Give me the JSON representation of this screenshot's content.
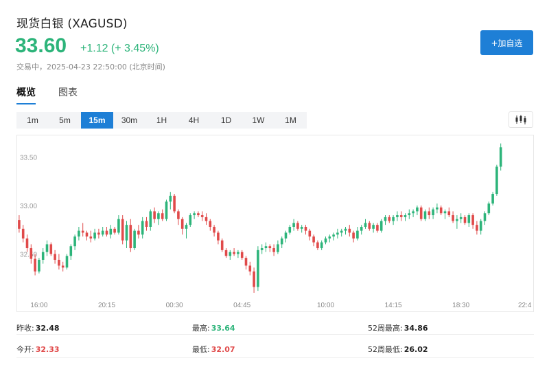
{
  "header": {
    "title": "现货白银 (XAGUSD)",
    "price": "33.60",
    "change": "+1.12 (+ 3.45%)",
    "status": "交易中，2025-04-23 22:50:00 (北京时间)",
    "follow_label": "+加自选"
  },
  "tabs": [
    {
      "label": "概览",
      "active": true
    },
    {
      "label": "图表",
      "active": false
    }
  ],
  "intervals": [
    {
      "label": "1m",
      "active": false
    },
    {
      "label": "5m",
      "active": false
    },
    {
      "label": "15m",
      "active": true
    },
    {
      "label": "30m",
      "active": false
    },
    {
      "label": "1H",
      "active": false
    },
    {
      "label": "4H",
      "active": false
    },
    {
      "label": "1D",
      "active": false
    },
    {
      "label": "1W",
      "active": false
    },
    {
      "label": "1M",
      "active": false
    }
  ],
  "chart_type_icon": "candlestick-icon",
  "colors": {
    "up": "#2db47a",
    "down": "#e04a4a",
    "accent": "#1e7fd6"
  },
  "chart_data": {
    "type": "candlestick",
    "y_ticks": [
      "33.50",
      "33.00",
      "32.50"
    ],
    "y_tick_values": [
      33.5,
      33.0,
      32.5
    ],
    "ylim": [
      32.05,
      33.68
    ],
    "x_ticks": [
      "16:00",
      "20:15",
      "00:30",
      "04:45",
      "10:00",
      "14:15",
      "18:30",
      "22:4"
    ],
    "x_tick_index": [
      5,
      22,
      39,
      56,
      77,
      94,
      111,
      128
    ],
    "n_slots": 130,
    "candles": [
      [
        32.85,
        32.9,
        32.72,
        32.76
      ],
      [
        32.76,
        32.8,
        32.62,
        32.66
      ],
      [
        32.66,
        32.7,
        32.52,
        32.56
      ],
      [
        32.56,
        32.6,
        32.4,
        32.45
      ],
      [
        32.45,
        32.5,
        32.28,
        32.32
      ],
      [
        32.32,
        32.46,
        32.3,
        32.44
      ],
      [
        32.44,
        32.56,
        32.4,
        32.52
      ],
      [
        32.52,
        32.64,
        32.48,
        32.6
      ],
      [
        32.6,
        32.62,
        32.48,
        32.5
      ],
      [
        32.5,
        32.54,
        32.4,
        32.44
      ],
      [
        32.44,
        32.5,
        32.34,
        32.38
      ],
      [
        32.38,
        32.42,
        32.32,
        32.36
      ],
      [
        32.36,
        32.5,
        32.34,
        32.48
      ],
      [
        32.48,
        32.6,
        32.44,
        32.58
      ],
      [
        32.58,
        32.7,
        32.54,
        32.68
      ],
      [
        32.68,
        32.78,
        32.64,
        32.74
      ],
      [
        32.74,
        32.82,
        32.68,
        32.72
      ],
      [
        32.72,
        32.74,
        32.64,
        32.68
      ],
      [
        32.68,
        32.74,
        32.62,
        32.66
      ],
      [
        32.66,
        32.76,
        32.64,
        32.72
      ],
      [
        32.72,
        32.76,
        32.66,
        32.7
      ],
      [
        32.7,
        32.78,
        32.68,
        32.74
      ],
      [
        32.74,
        32.78,
        32.68,
        32.7
      ],
      [
        32.7,
        32.8,
        32.66,
        32.76
      ],
      [
        32.76,
        32.78,
        32.7,
        32.72
      ],
      [
        32.72,
        32.9,
        32.7,
        32.86
      ],
      [
        32.86,
        32.9,
        32.6,
        32.64
      ],
      [
        32.64,
        32.84,
        32.56,
        32.8
      ],
      [
        32.8,
        32.86,
        32.52,
        32.56
      ],
      [
        32.56,
        32.76,
        32.54,
        32.74
      ],
      [
        32.74,
        32.8,
        32.66,
        32.7
      ],
      [
        32.7,
        32.88,
        32.66,
        32.84
      ],
      [
        32.84,
        32.88,
        32.74,
        32.78
      ],
      [
        32.78,
        32.96,
        32.74,
        32.94
      ],
      [
        32.94,
        32.98,
        32.82,
        32.86
      ],
      [
        32.86,
        32.94,
        32.8,
        32.92
      ],
      [
        32.92,
        32.96,
        32.84,
        32.86
      ],
      [
        32.86,
        33.06,
        32.84,
        33.04
      ],
      [
        33.04,
        33.14,
        32.96,
        33.1
      ],
      [
        33.1,
        33.12,
        32.92,
        32.94
      ],
      [
        32.94,
        32.96,
        32.8,
        32.86
      ],
      [
        32.86,
        32.88,
        32.7,
        32.76
      ],
      [
        32.76,
        32.82,
        32.66,
        32.8
      ],
      [
        32.8,
        32.92,
        32.78,
        32.9
      ],
      [
        32.9,
        32.94,
        32.86,
        32.92
      ],
      [
        32.92,
        32.94,
        32.88,
        32.9
      ],
      [
        32.9,
        32.94,
        32.84,
        32.88
      ],
      [
        32.88,
        32.92,
        32.8,
        32.84
      ],
      [
        32.84,
        32.86,
        32.74,
        32.78
      ],
      [
        32.78,
        32.8,
        32.68,
        32.72
      ],
      [
        32.72,
        32.74,
        32.6,
        32.64
      ],
      [
        32.64,
        32.66,
        32.52,
        32.54
      ],
      [
        32.54,
        32.56,
        32.46,
        32.48
      ],
      [
        32.48,
        32.54,
        32.44,
        32.52
      ],
      [
        32.52,
        32.56,
        32.48,
        32.5
      ],
      [
        32.5,
        32.54,
        32.46,
        32.52
      ],
      [
        32.52,
        32.54,
        32.44,
        32.46
      ],
      [
        32.46,
        32.48,
        32.34,
        32.38
      ],
      [
        32.38,
        32.42,
        32.28,
        32.32
      ],
      [
        32.32,
        32.36,
        32.1,
        32.16
      ],
      [
        32.16,
        32.58,
        32.12,
        32.54
      ],
      [
        32.54,
        32.6,
        32.5,
        32.56
      ],
      [
        32.56,
        32.62,
        32.52,
        32.58
      ],
      [
        32.58,
        32.6,
        32.52,
        32.56
      ],
      [
        32.56,
        32.6,
        32.48,
        32.52
      ],
      [
        32.52,
        32.64,
        32.5,
        32.6
      ],
      [
        32.6,
        32.68,
        32.56,
        32.66
      ],
      [
        32.66,
        32.74,
        32.62,
        32.72
      ],
      [
        32.72,
        32.8,
        32.7,
        32.78
      ],
      [
        32.78,
        32.86,
        32.74,
        32.82
      ],
      [
        32.82,
        32.84,
        32.74,
        32.76
      ],
      [
        32.76,
        32.8,
        32.72,
        32.78
      ],
      [
        32.78,
        32.8,
        32.7,
        32.74
      ],
      [
        32.74,
        32.76,
        32.64,
        32.68
      ],
      [
        32.68,
        32.7,
        32.58,
        32.62
      ],
      [
        32.62,
        32.64,
        32.54,
        32.56
      ],
      [
        32.56,
        32.64,
        32.54,
        32.62
      ],
      [
        32.62,
        32.68,
        32.6,
        32.66
      ],
      [
        32.66,
        32.7,
        32.62,
        32.68
      ],
      [
        32.68,
        32.72,
        32.64,
        32.7
      ],
      [
        32.7,
        32.76,
        32.66,
        32.72
      ],
      [
        32.72,
        32.76,
        32.68,
        32.74
      ],
      [
        32.74,
        32.78,
        32.7,
        32.76
      ],
      [
        32.76,
        32.8,
        32.68,
        32.72
      ],
      [
        32.72,
        32.74,
        32.62,
        32.66
      ],
      [
        32.66,
        32.78,
        32.64,
        32.74
      ],
      [
        32.74,
        32.8,
        32.7,
        32.78
      ],
      [
        32.78,
        32.86,
        32.76,
        32.82
      ],
      [
        32.82,
        32.84,
        32.74,
        32.76
      ],
      [
        32.76,
        32.82,
        32.72,
        32.8
      ],
      [
        32.8,
        32.82,
        32.72,
        32.74
      ],
      [
        32.74,
        32.86,
        32.72,
        32.84
      ],
      [
        32.84,
        32.9,
        32.8,
        32.88
      ],
      [
        32.88,
        32.9,
        32.82,
        32.84
      ],
      [
        32.84,
        32.9,
        32.8,
        32.88
      ],
      [
        32.88,
        32.94,
        32.84,
        32.9
      ],
      [
        32.9,
        32.94,
        32.84,
        32.88
      ],
      [
        32.88,
        32.92,
        32.84,
        32.9
      ],
      [
        32.9,
        32.96,
        32.86,
        32.92
      ],
      [
        32.92,
        32.96,
        32.88,
        32.94
      ],
      [
        32.94,
        33.0,
        32.9,
        32.98
      ],
      [
        32.98,
        33.0,
        32.84,
        32.86
      ],
      [
        32.86,
        32.96,
        32.84,
        32.94
      ],
      [
        32.94,
        32.98,
        32.86,
        32.9
      ],
      [
        32.9,
        32.98,
        32.86,
        32.96
      ],
      [
        32.96,
        33.02,
        32.92,
        32.98
      ],
      [
        32.98,
        33.0,
        32.9,
        32.92
      ],
      [
        32.92,
        32.96,
        32.86,
        32.94
      ],
      [
        32.94,
        32.98,
        32.88,
        32.9
      ],
      [
        32.9,
        32.94,
        32.82,
        32.84
      ],
      [
        32.84,
        32.9,
        32.76,
        32.86
      ],
      [
        32.86,
        32.92,
        32.82,
        32.88
      ],
      [
        32.88,
        32.9,
        32.8,
        32.82
      ],
      [
        32.82,
        32.92,
        32.78,
        32.9
      ],
      [
        32.9,
        32.92,
        32.76,
        32.8
      ],
      [
        32.8,
        32.84,
        32.7,
        32.74
      ],
      [
        32.74,
        32.86,
        32.7,
        32.84
      ],
      [
        32.84,
        32.94,
        32.8,
        32.92
      ],
      [
        32.92,
        33.04,
        32.9,
        33.02
      ],
      [
        33.02,
        33.14,
        33.0,
        33.12
      ],
      [
        33.12,
        33.42,
        33.1,
        33.4
      ],
      [
        33.4,
        33.64,
        33.36,
        33.6
      ]
    ]
  },
  "stats": {
    "row1": [
      {
        "label": "昨收:",
        "value": "32.48",
        "tone": "dark"
      },
      {
        "label": "最高:",
        "value": "33.64",
        "tone": "green"
      },
      {
        "label": "52周最高:",
        "value": "34.86",
        "tone": "dark"
      }
    ],
    "row2": [
      {
        "label": "今开:",
        "value": "32.33",
        "tone": "red"
      },
      {
        "label": "最低:",
        "value": "32.07",
        "tone": "red"
      },
      {
        "label": "52周最低:",
        "value": "26.02",
        "tone": "dark"
      }
    ]
  }
}
